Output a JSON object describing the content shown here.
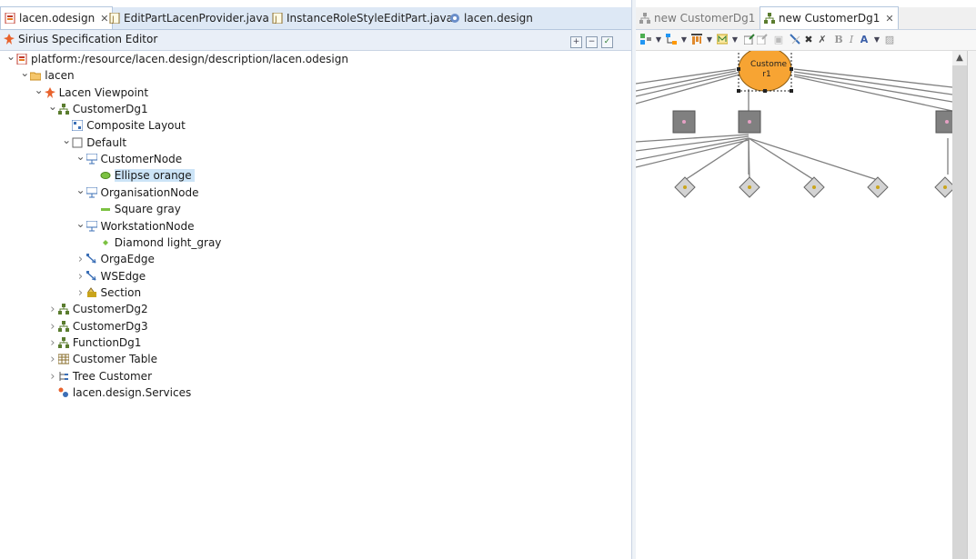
{
  "left_tabs": [
    {
      "label": "lacen.odesign",
      "active": true,
      "closable": true,
      "icon": "odesign-file-icon"
    },
    {
      "label": "EditPartLacenProvider.java",
      "active": false,
      "icon": "java-file-icon"
    },
    {
      "label": "InstanceRoleStyleEditPart.java",
      "active": false,
      "icon": "java-file-icon"
    },
    {
      "label": "lacen.design",
      "active": false,
      "icon": "project-icon"
    }
  ],
  "editor": {
    "title": "Sirius Specification Editor",
    "header_buttons": [
      "expand-all-icon",
      "collapse-all-icon",
      "validate-icon"
    ]
  },
  "tree": [
    {
      "label": "platform:/resource/lacen.design/description/lacen.odesign",
      "indent": 0,
      "twisty": "open",
      "icon": "resource-icon"
    },
    {
      "label": "lacen",
      "indent": 1,
      "twisty": "open",
      "icon": "group-folder-icon"
    },
    {
      "label": "Lacen Viewpoint",
      "indent": 2,
      "twisty": "open",
      "icon": "viewpoint-icon"
    },
    {
      "label": "CustomerDg1",
      "indent": 3,
      "twisty": "open",
      "icon": "diagram-icon"
    },
    {
      "label": "Composite Layout",
      "indent": 4,
      "twisty": "none",
      "icon": "layout-icon"
    },
    {
      "label": "Default",
      "indent": 4,
      "twisty": "open",
      "icon": "layer-icon"
    },
    {
      "label": "CustomerNode",
      "indent": 5,
      "twisty": "open",
      "icon": "node-mapping-icon"
    },
    {
      "label": "Ellipse orange",
      "indent": 6,
      "twisty": "none",
      "icon": "ellipse-style-icon",
      "selected": true
    },
    {
      "label": "OrganisationNode",
      "indent": 5,
      "twisty": "open",
      "icon": "node-mapping-icon"
    },
    {
      "label": "Square gray",
      "indent": 6,
      "twisty": "none",
      "icon": "square-style-icon"
    },
    {
      "label": "WorkstationNode",
      "indent": 5,
      "twisty": "open",
      "icon": "node-mapping-icon"
    },
    {
      "label": "Diamond light_gray",
      "indent": 6,
      "twisty": "none",
      "icon": "diamond-style-icon"
    },
    {
      "label": "OrgaEdge",
      "indent": 5,
      "twisty": "closed",
      "icon": "edge-mapping-icon"
    },
    {
      "label": "WSEdge",
      "indent": 5,
      "twisty": "closed",
      "icon": "edge-mapping-icon"
    },
    {
      "label": "Section",
      "indent": 5,
      "twisty": "closed",
      "icon": "tool-section-icon"
    },
    {
      "label": "CustomerDg2",
      "indent": 3,
      "twisty": "closed",
      "icon": "diagram-icon"
    },
    {
      "label": "CustomerDg3",
      "indent": 3,
      "twisty": "closed",
      "icon": "diagram-icon"
    },
    {
      "label": "FunctionDg1",
      "indent": 3,
      "twisty": "closed",
      "icon": "diagram-icon"
    },
    {
      "label": "Customer Table",
      "indent": 3,
      "twisty": "closed",
      "icon": "table-icon"
    },
    {
      "label": "Tree Customer",
      "indent": 3,
      "twisty": "closed",
      "icon": "tree-icon"
    },
    {
      "label": "lacen.design.Services",
      "indent": 3,
      "twisty": "none",
      "icon": "java-extension-icon"
    }
  ],
  "right_tabs": [
    {
      "label": "new CustomerDg1",
      "active": false,
      "icon": "diagram-icon"
    },
    {
      "label": "new CustomerDg1",
      "active": true,
      "closable": true,
      "icon": "diagram-icon"
    }
  ],
  "diagram": {
    "selected_node_label": "Custome\nr1",
    "selected_node_line1": "Custome",
    "selected_node_line2": "r1",
    "colors": {
      "customer": "#f7a433",
      "organisation": "#808080",
      "workstation": "#d3d3d3",
      "edge": "#808080"
    }
  },
  "toolbar_glyphs": [
    "B",
    "I",
    "A"
  ]
}
